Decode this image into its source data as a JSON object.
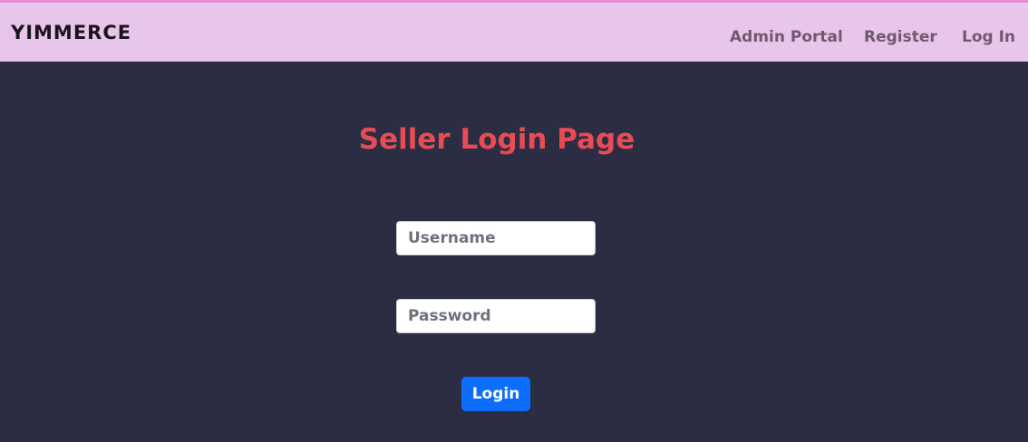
{
  "navbar": {
    "brand": "YIMMERCE",
    "links": [
      {
        "label": "Admin Portal"
      },
      {
        "label": "Register"
      },
      {
        "label": "Log In"
      }
    ]
  },
  "main": {
    "title": "Seller Login Page",
    "username": {
      "value": "",
      "placeholder": "Username"
    },
    "password": {
      "value": "",
      "placeholder": "Password"
    },
    "login_button": "Login"
  },
  "colors": {
    "navbar_bg": "#e8c5ea",
    "page_bg": "#2b2d42",
    "title": "#e94b55",
    "button": "#0d6efd"
  }
}
